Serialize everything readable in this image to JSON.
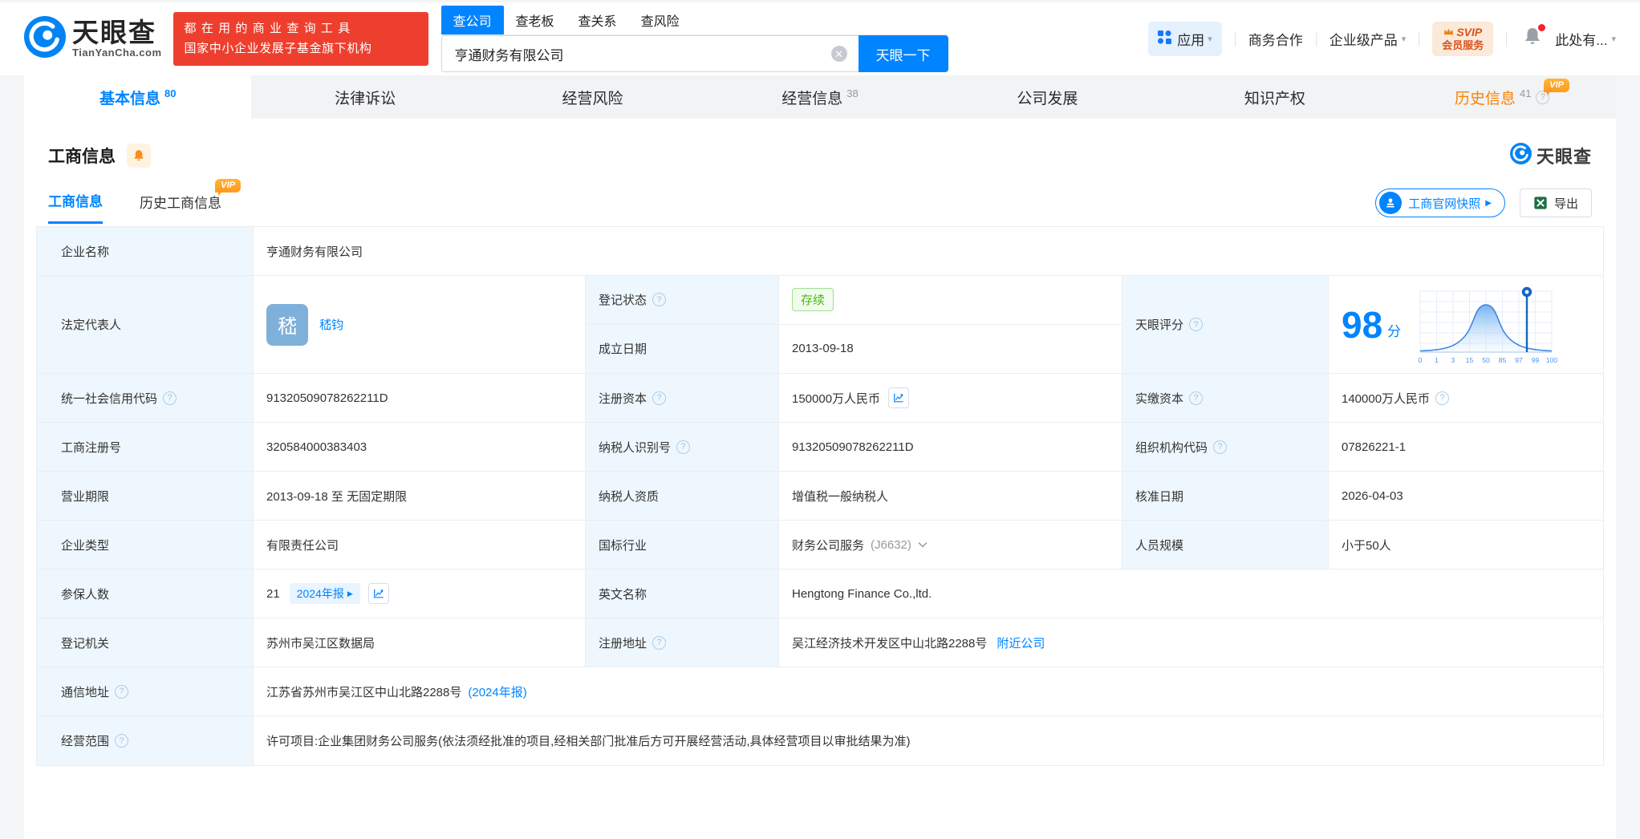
{
  "header": {
    "logo": {
      "name": "天眼查",
      "domain": "TianYanCha.com"
    },
    "promo": {
      "line1": "都在用的商业查询工具",
      "line2": "国家中小企业发展子基金旗下机构"
    },
    "search": {
      "tabs": [
        {
          "label": "查公司"
        },
        {
          "label": "查老板"
        },
        {
          "label": "查关系"
        },
        {
          "label": "查风险"
        }
      ],
      "value": "亨通财务有限公司",
      "submit": "天眼一下"
    },
    "menu": {
      "apps": "应用",
      "business": "商务合作",
      "enterprise": "企业级产品",
      "svip_top": "SVIP",
      "svip_bottom": "会员服务",
      "more": "此处有..."
    }
  },
  "nav_tabs": [
    {
      "label": "基本信息",
      "count": "80"
    },
    {
      "label": "法律诉讼",
      "count": ""
    },
    {
      "label": "经营风险",
      "count": ""
    },
    {
      "label": "经营信息",
      "count": "38"
    },
    {
      "label": "公司发展",
      "count": ""
    },
    {
      "label": "知识产权",
      "count": ""
    },
    {
      "label": "历史信息",
      "count": "41"
    }
  ],
  "vip_label": "VIP",
  "section": {
    "title": "工商信息",
    "watermark": "天眼查",
    "subtab_active": "工商信息",
    "subtab_history": "历史工商信息",
    "snapshot_button": "工商官网快照",
    "export_button": "导出"
  },
  "company": {
    "name_label": "企业名称",
    "name": "亨通财务有限公司",
    "legal_rep_label": "法定代表人",
    "legal_rep_avatar": "嵇",
    "legal_rep_name": "嵇钧",
    "reg_status_label": "登记状态",
    "reg_status": "存续",
    "establish_date_label": "成立日期",
    "establish_date": "2013-09-18",
    "score_label": "天眼评分",
    "score_value": "98",
    "score_unit": "分",
    "credit_code_label": "统一社会信用代码",
    "credit_code": "91320509078262211D",
    "reg_capital_label": "注册资本",
    "reg_capital": "150000万人民币",
    "paid_capital_label": "实缴资本",
    "paid_capital": "140000万人民币",
    "reg_number_label": "工商注册号",
    "reg_number": "320584000383403",
    "taxpayer_id_label": "纳税人识别号",
    "taxpayer_id": "91320509078262211D",
    "org_code_label": "组织机构代码",
    "org_code": "07826221-1",
    "business_term_label": "营业期限",
    "business_term": "2013-09-18 至 无固定期限",
    "taxpayer_quality_label": "纳税人资质",
    "taxpayer_quality": "增值税一般纳税人",
    "approval_date_label": "核准日期",
    "approval_date": "2026-04-03",
    "company_type_label": "企业类型",
    "company_type": "有限责任公司",
    "industry_label": "国标行业",
    "industry": "财务公司服务",
    "industry_code": "(J6632)",
    "staff_size_label": "人员规模",
    "staff_size": "小于50人",
    "insured_label": "参保人数",
    "insured": "21",
    "annual_report_tag": "2024年报",
    "english_name_label": "英文名称",
    "english_name": "Hengtong Finance Co.,ltd.",
    "registry_label": "登记机关",
    "registry": "苏州市吴江区数据局",
    "address_label": "注册地址",
    "address": "吴江经济技术开发区中山北路2288号",
    "nearby_link": "附近公司",
    "mail_address_label": "通信地址",
    "mail_address": "江苏省苏州市吴江区中山北路2288号",
    "mail_report_link": "(2024年报)",
    "scope_label": "经营范围",
    "scope": "许可项目:企业集团财务公司服务(依法须经批准的项目,经相关部门批准后方可开展经营活动,具体经营项目以审批结果为准)"
  },
  "score_chart": {
    "type": "area",
    "x_labels": [
      "0",
      "1",
      "3",
      "15",
      "50",
      "85",
      "97",
      "99",
      "100"
    ],
    "marker_value": 98,
    "shape": "normal-distribution-curve"
  },
  "icons": {
    "chevron_down": "▾",
    "play": "▶",
    "clear": "✕",
    "question": "?"
  },
  "colors": {
    "brand_blue": "#0084ff",
    "banner_red": "#ee3f2e",
    "vip_orange": "#ff9a1f",
    "status_green": "#49b812",
    "label_cell_bg": "#eef7fd"
  }
}
